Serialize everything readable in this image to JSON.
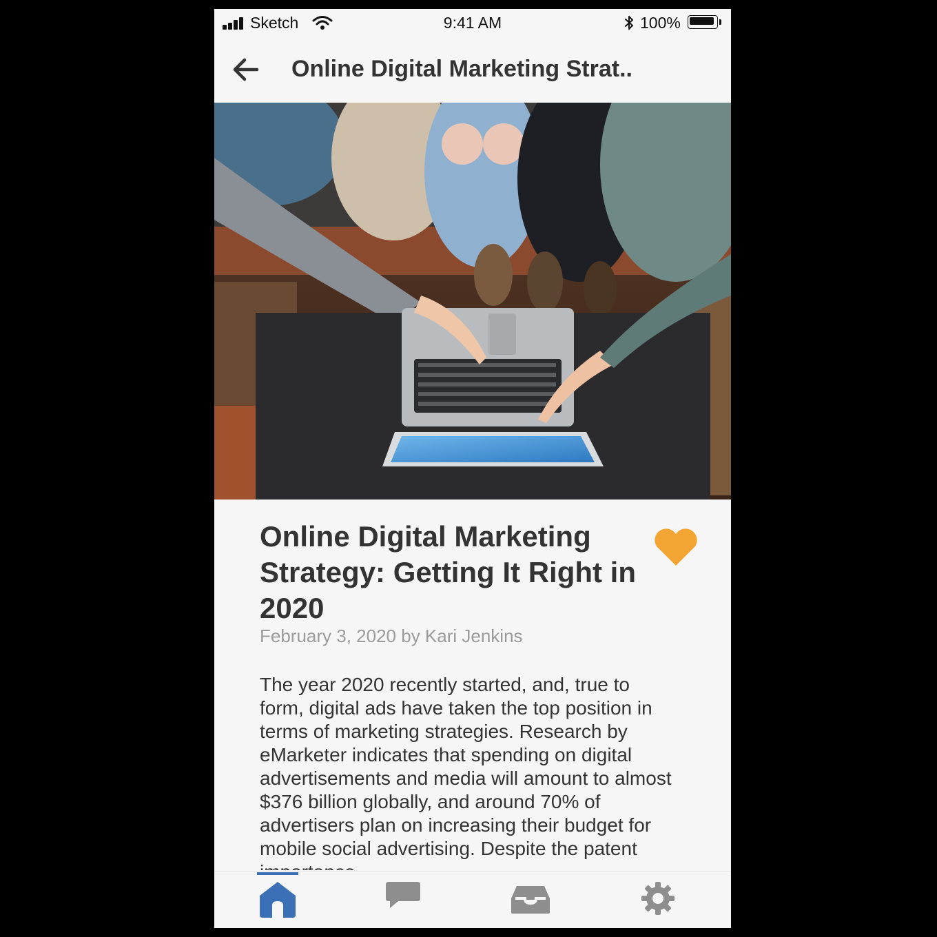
{
  "status_bar": {
    "carrier": "Sketch",
    "time": "9:41 AM",
    "battery": "100%"
  },
  "nav": {
    "title": "Online Digital Marketing Strat.."
  },
  "hero_image": {
    "description": "overhead photo of people pointing at a laptop and tablet"
  },
  "article": {
    "title": "Online Digital Marketing Strategy: Getting It Right in 2020",
    "meta": "February 3, 2020 by Kari Jenkins",
    "body": "The year 2020 recently started, and, true to form, digital ads have taken the top position in terms of marketing strategies. Research by eMarketer indicates that spending on digital advertisements and media will amount to almost $376 billion globally, and around 70% of advertisers plan on increasing their budget for mobile social advertising. Despite the patent importance",
    "favorited": true
  },
  "tab_bar": {
    "items": [
      {
        "icon": "home-icon",
        "active": true
      },
      {
        "icon": "chat-icon",
        "active": false
      },
      {
        "icon": "inbox-icon",
        "active": false
      },
      {
        "icon": "settings-icon",
        "active": false
      }
    ]
  },
  "colors": {
    "accent": "#3b6fb6",
    "favorite": "#f3a533",
    "inactive_icon": "#8e8e8e",
    "text": "#333333",
    "meta_text": "#9b9b9b",
    "background": "#f6f6f6"
  }
}
